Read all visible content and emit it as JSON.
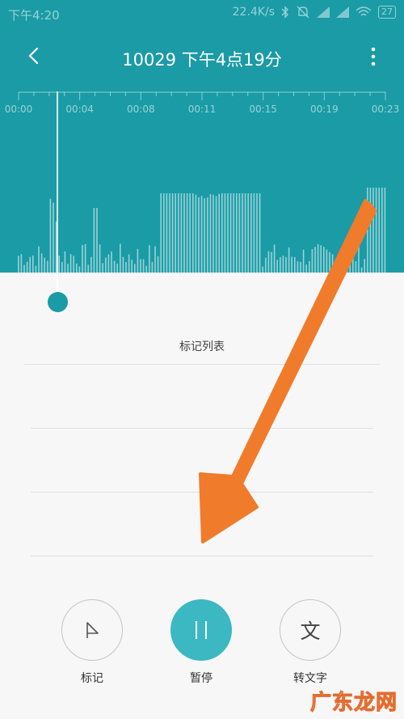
{
  "status_bar": {
    "time": "下午4:20",
    "network_speed": "22.4K/s",
    "battery": "27",
    "icons": [
      "bluetooth-icon",
      "mute-icon",
      "signal-icon",
      "signal-icon",
      "wifi-icon",
      "battery-icon"
    ]
  },
  "header": {
    "title": "10029  下午4点19分",
    "back_icon": "chevron-left-icon",
    "more_icon": "more-vertical-icon"
  },
  "timeline": {
    "labels": [
      "00:00",
      "00:04",
      "00:08",
      "00:11",
      "00:15",
      "00:19",
      "00:23"
    ]
  },
  "marks": {
    "title": "标记列表"
  },
  "controls": {
    "mark_label": "标记",
    "pause_label": "暂停",
    "transcribe_label": "转文字",
    "transcribe_glyph": "文"
  },
  "colors": {
    "accent": "#1a9ba6",
    "button_primary": "#3cb8c2",
    "arrow": "#f07b2b"
  },
  "watermark": "广东龙网"
}
